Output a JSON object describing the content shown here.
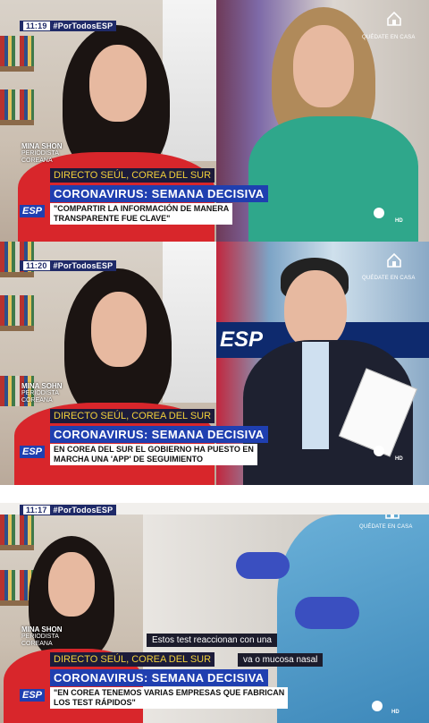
{
  "frames": [
    {
      "time": "11:19",
      "hashtag": "#PorTodosESP",
      "name": "MINA SHON",
      "role": "PERIODISTA",
      "role2": "COREANA",
      "location": "DIRECTO SEÚL, COREA DEL SUR",
      "headline": "CORONAVIRUS: SEMANA DECISIVA",
      "quote_line1": "\"COMPARTIR LA INFORMACIÓN DE MANERA",
      "quote_line2": "TRANSPARENTE FUE CLAVE\"",
      "logo": "ESP",
      "home_label": "QUÉDATE EN CASA",
      "hd": "HD"
    },
    {
      "time": "11:20",
      "hashtag": "#PorTodosESP",
      "name": "MINA SOHN",
      "role": "PERIODISTA",
      "role2": "COREANA",
      "location": "DIRECTO SEÚL, COREA DEL SUR",
      "headline": "CORONAVIRUS: SEMANA DECISIVA",
      "quote_line1": "EN COREA DEL SUR EL GOBIERNO HA PUESTO EN",
      "quote_line2": "MARCHA UNA 'APP' DE SEGUIMIENTO",
      "logo": "ESP",
      "home_label": "QUÉDATE EN CASA",
      "hd": "HD",
      "wall_logo": "ESP"
    },
    {
      "time": "11:17",
      "hashtag": "#PorTodosESP",
      "name": "MINA SHON",
      "role": "PERIODISTA",
      "role2": "COREANA",
      "location": "DIRECTO SEÚL, COREA DEL SUR",
      "subtitle_1": "Estos test reaccionan con una",
      "subtitle_2": "va o mucosa nasal",
      "headline": "CORONAVIRUS: SEMANA DECISIVA",
      "quote_line1": "\"EN COREA TENEMOS VARIAS EMPRESAS QUE FABRICAN",
      "quote_line2": "LOS TEST RÁPIDOS\"",
      "logo": "ESP",
      "home_label": "QUÉDATE EN CASA",
      "hd": "HD"
    }
  ],
  "colors": {
    "headline_bg": "#1f3fb0",
    "location_text": "#f3d13a",
    "tag_bg": "#1f2a68",
    "shirt_red": "#d8262b",
    "anchor_green": "#2fa78b"
  }
}
